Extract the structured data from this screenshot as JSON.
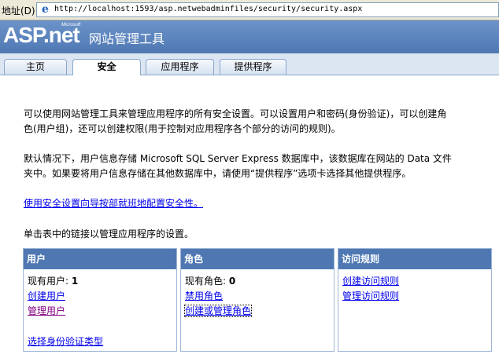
{
  "address_bar": {
    "label": "地址(D)",
    "url": "http://localhost:1593/asp.netwebadminfiles/security/security.aspx"
  },
  "header": {
    "logo": "ASP.net",
    "logo_microsoft": "Microsoft",
    "title": "网站管理工具"
  },
  "tabs": [
    {
      "label": "主页",
      "active": false
    },
    {
      "label": "安全",
      "active": true
    },
    {
      "label": "应用程序",
      "active": false
    },
    {
      "label": "提供程序",
      "active": false
    }
  ],
  "main": {
    "intro_line1": "可以使用网站管理工具来管理应用程序的所有安全设置。可以设置用户和密码(身份验证)，可以创建角",
    "intro_line2": "色(用户组)，还可以创建权限(用于控制对应用程序各个部分的访问的规则)。",
    "storage_line1": "默认情况下，用户信息存储 Microsoft SQL Server Express 数据库中，该数据库在网站的 Data 文件",
    "storage_line2": "夹中。如果要将用户信息存储在其他数据库中，请使用“提供程序”选项卡选择其他提供程序。",
    "wizard_link": "使用安全设置向导按部就班地配置安全性。",
    "table_instruction": "单击表中的链接以管理应用程序的设置。"
  },
  "panels": {
    "users": {
      "header": "用户",
      "existing_label": "现有用户:",
      "existing_count": "1",
      "create_link": "创建用户",
      "manage_link": "管理用户",
      "auth_type_link": "选择身份验证类型"
    },
    "roles": {
      "header": "角色",
      "existing_label": "现有角色:",
      "existing_count": "0",
      "disable_link": "禁用角色",
      "create_manage_link": "创建或管理角色"
    },
    "access": {
      "header": "访问规则",
      "create_link": "创建访问规则",
      "manage_link": "管理访问规则"
    }
  },
  "colors": {
    "header_blue": "#4f78b3",
    "link": "#0000ee",
    "visited_link": "#800080"
  }
}
